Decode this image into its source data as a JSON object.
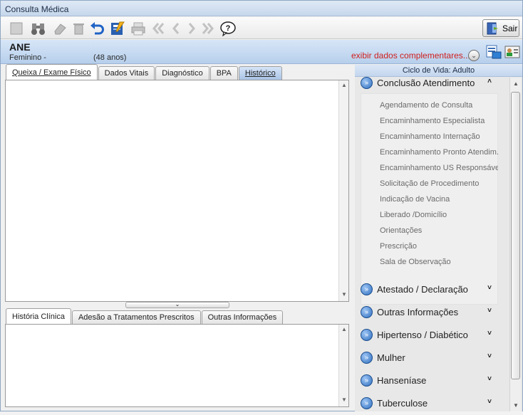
{
  "window": {
    "title": "Consulta Médica"
  },
  "toolbar": {
    "buttons": [
      "new-icon",
      "binoculars-icon",
      "eraser-icon",
      "trash-icon",
      "undo-icon",
      "edit-icon",
      "print-icon",
      "first-icon",
      "prev-icon",
      "next-icon",
      "last-icon",
      "help-icon"
    ],
    "exit_label": "Sair"
  },
  "patient": {
    "name": "ANE",
    "sex": "Feminino -",
    "age": "(48 anos)",
    "more_link": "exibir dados complementares...",
    "link_color": "#d0201e"
  },
  "top_tabs": [
    "Queixa / Exame Físico",
    "Dados Vitais",
    "Diagnóstico",
    "BPA",
    "Histórico"
  ],
  "bottom_tabs": [
    "História Clínica",
    "Adesão a Tratamentos Prescritos",
    "Outras Informações"
  ],
  "side": {
    "life_cycle": "Ciclo de Vida: Adulto",
    "expanded_group": {
      "label": "Conclusão Atendimento",
      "items": [
        "Agendamento de Consulta",
        "Encaminhamento Especialista",
        "Encaminhamento Internação",
        "Encaminhamento Pronto Atendim...",
        "Encaminhamento US Responsável",
        "Solicitação de Procedimento",
        "Indicação de Vacina",
        "Liberado /Domicílio",
        "Orientações",
        "Prescrição",
        "Sala de Observação"
      ]
    },
    "groups": [
      "Atestado / Declaração",
      "Outras Informações",
      "Hipertenso / Diabético",
      "Mulher",
      "Hanseníase",
      "Tuberculose"
    ]
  }
}
